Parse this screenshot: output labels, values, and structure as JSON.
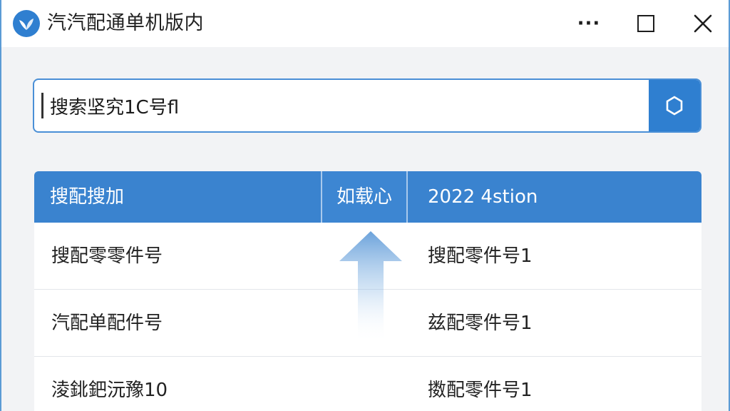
{
  "window": {
    "title": "汽汽配通单机版内",
    "more_label": "···"
  },
  "search": {
    "value": "搜索坚究1C号fl",
    "search_icon": "hexagon-search-icon"
  },
  "table": {
    "columns": [
      "搜配搜加",
      "如载心",
      "2022 4stion"
    ],
    "rows": [
      {
        "name": "搜配零零件号",
        "value": "搜配零件号1"
      },
      {
        "name": "汽配单配件号",
        "value": "兹配零件号1"
      },
      {
        "name": "淩鉳鈀沅豫10",
        "value": "擞配零件号1"
      }
    ]
  },
  "colors": {
    "accent": "#2f7fd0",
    "header": "#3a83cf",
    "border": "#5b9bd5"
  }
}
